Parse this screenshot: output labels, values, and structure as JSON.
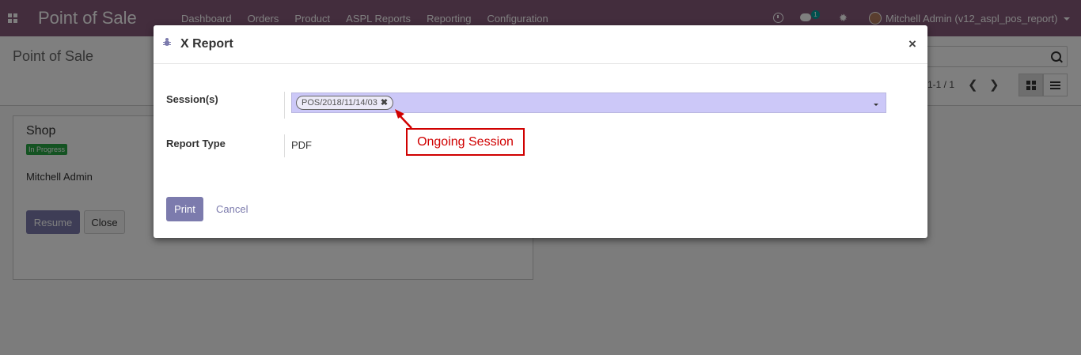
{
  "navbar": {
    "brand": "Point of Sale",
    "menu": [
      "Dashboard",
      "Orders",
      "Product",
      "ASPL Reports",
      "Reporting",
      "Configuration"
    ],
    "chat_badge": "1",
    "user": "Mitchell Admin (v12_aspl_pos_report)"
  },
  "background": {
    "page_title": "Point of Sale",
    "pager": "1-1 / 1",
    "card": {
      "title": "Shop",
      "status_badge": "In Progress",
      "user": "Mitchell Admin",
      "resume_label": "Resume",
      "close_label": "Close"
    }
  },
  "modal": {
    "title": "X Report",
    "close_glyph": "×",
    "sessions_label": "Session(s)",
    "session_tag": "POS/2018/11/14/03",
    "tag_remove_glyph": "✖",
    "report_type_label": "Report Type",
    "report_type_value": "PDF",
    "print_label": "Print",
    "cancel_label": "Cancel"
  },
  "annotation": {
    "text": "Ongoing Session",
    "color": "#d00000"
  },
  "colors": {
    "navbar": "#875a7b",
    "primary_button": "#7c7bad",
    "session_input_bg": "#ccc8f8",
    "badge_green": "#28a745"
  },
  "icons": [
    "apps-icon",
    "clock-icon",
    "chat-icon",
    "debug-icon",
    "avatar",
    "search-icon",
    "kanban-view-icon",
    "list-view-icon",
    "tag-remove-icon",
    "close-icon"
  ]
}
